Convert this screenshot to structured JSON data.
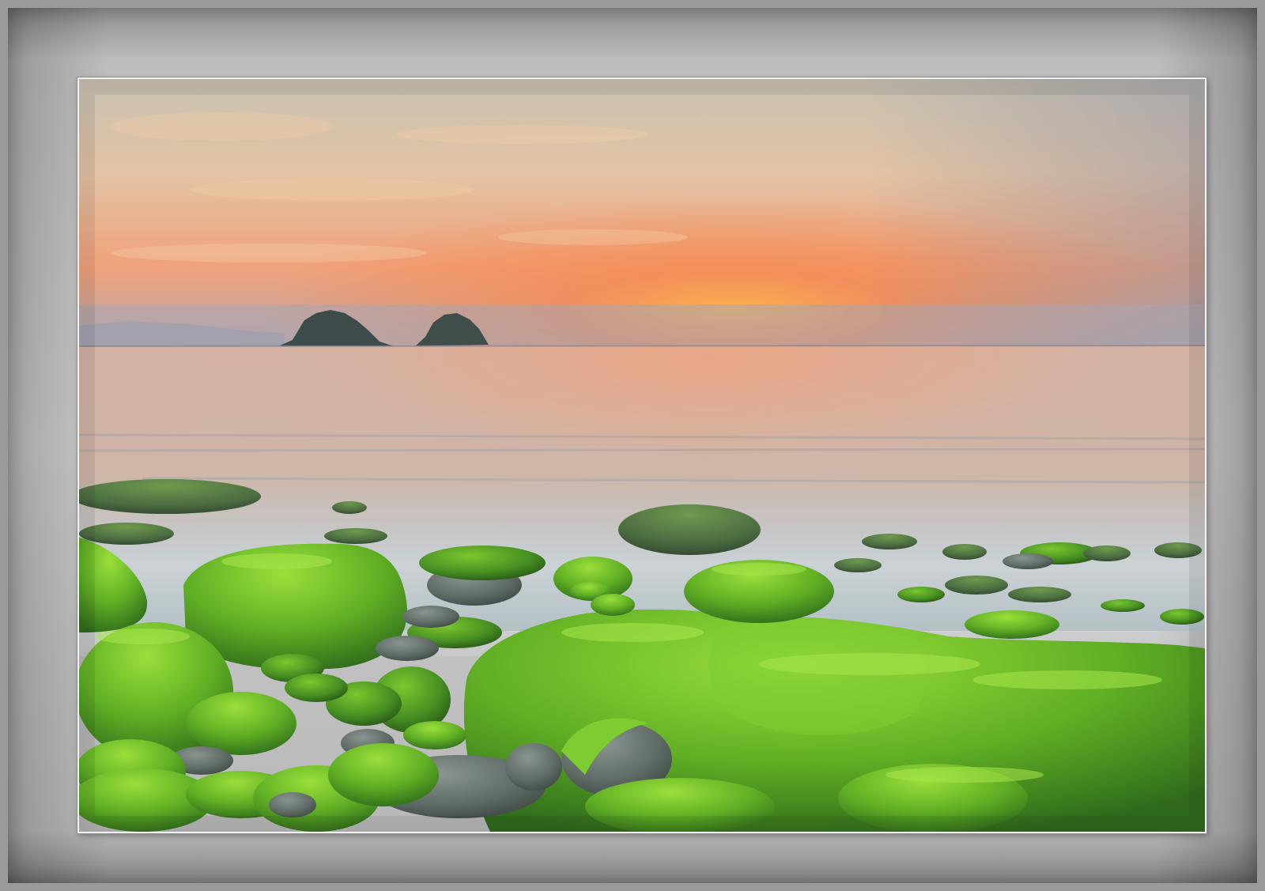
{
  "scene": {
    "subject": "seascape",
    "colors": {
      "mat": "#c4c4c4",
      "sky_top": "#c9c3ba",
      "sky_glow": "#f58a55",
      "sea": "#d9b7a3",
      "moss": "#6fbf2c",
      "stone": "#5d6862"
    }
  }
}
